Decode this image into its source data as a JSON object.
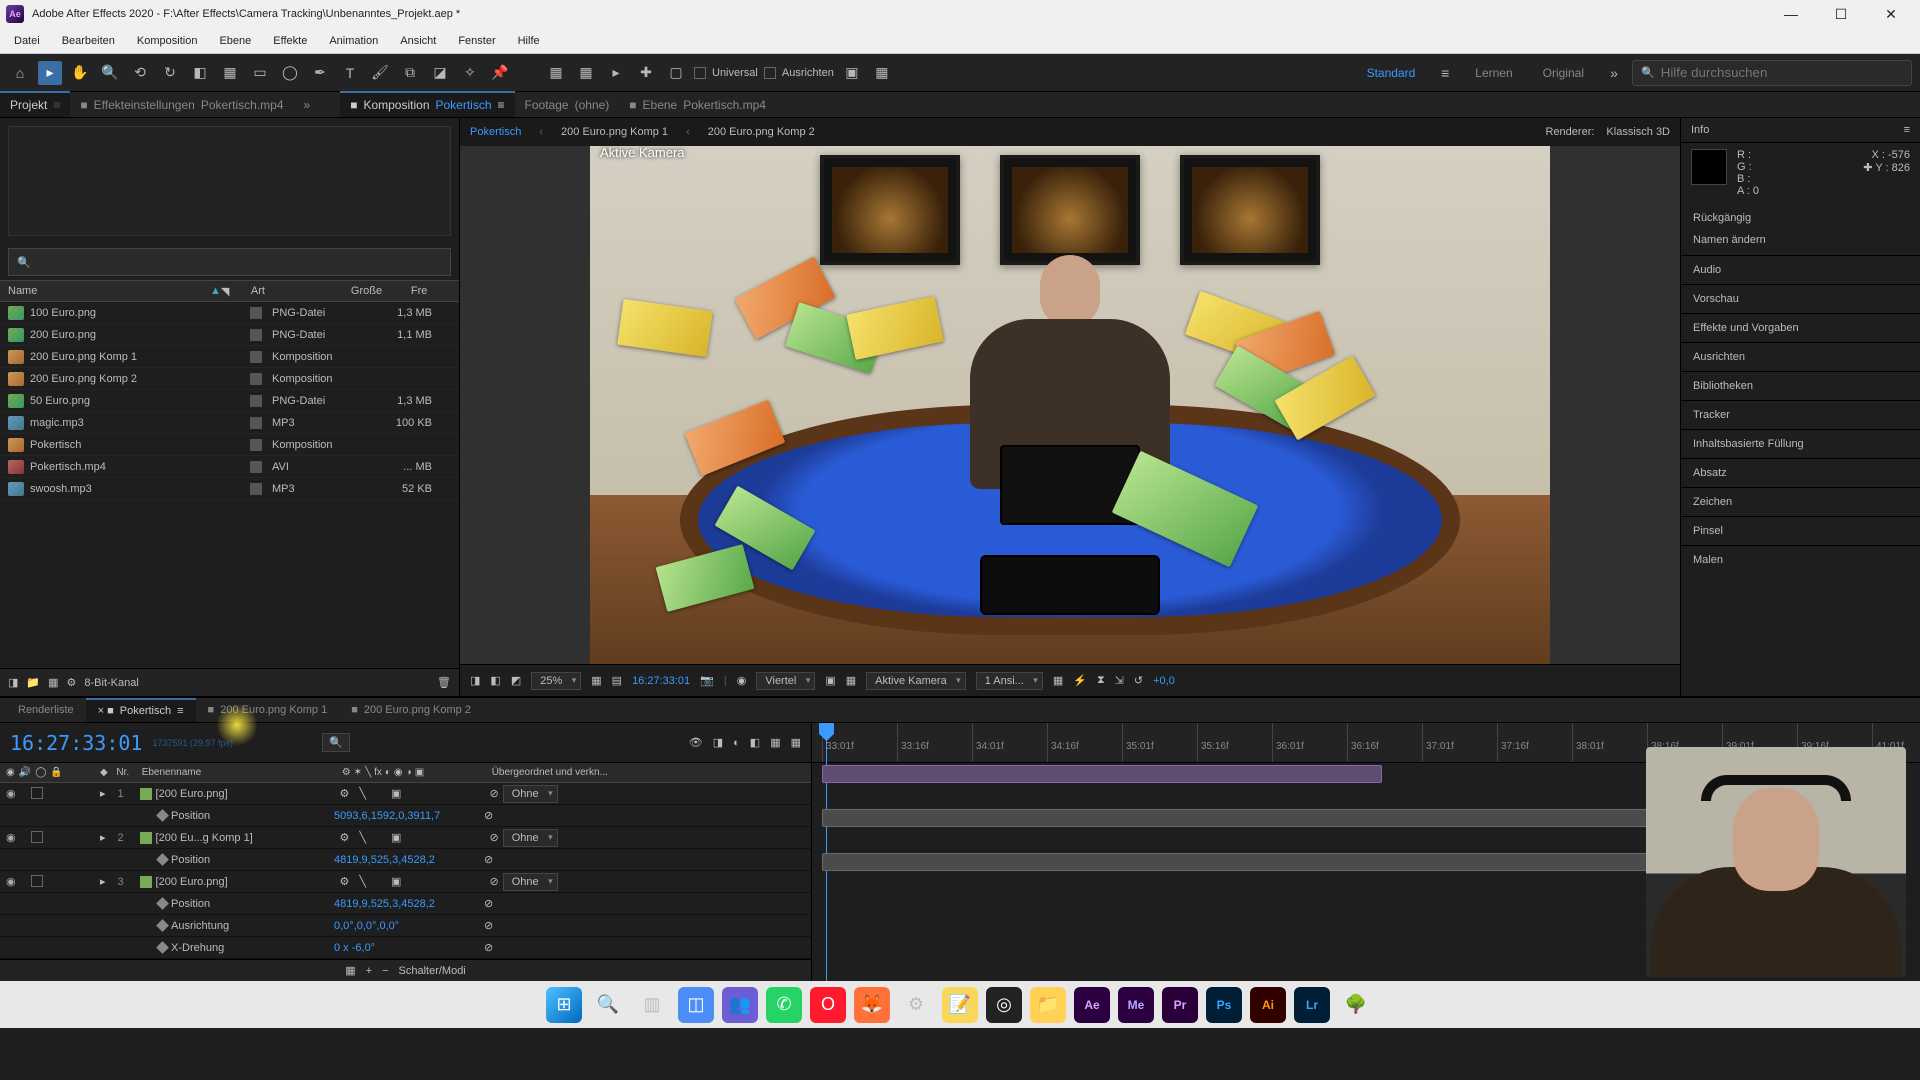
{
  "title": "Adobe After Effects 2020 - F:\\After Effects\\Camera Tracking\\Unbenanntes_Projekt.aep *",
  "menus": [
    "Datei",
    "Bearbeiten",
    "Komposition",
    "Ebene",
    "Effekte",
    "Animation",
    "Ansicht",
    "Fenster",
    "Hilfe"
  ],
  "toolbar": {
    "universal": "Universal",
    "align": "Ausrichten",
    "workspaces": {
      "standard": "Standard",
      "learn": "Lernen",
      "original": "Original"
    },
    "help_placeholder": "Hilfe durchsuchen"
  },
  "top_tabs": {
    "project": "Projekt",
    "effect_controls": {
      "label": "Effekteinstellungen",
      "item": "Pokertisch.mp4"
    },
    "comp": {
      "label": "Komposition",
      "item": "Pokertisch"
    },
    "footage": {
      "label": "Footage",
      "item": "(ohne)"
    },
    "layer": {
      "label": "Ebene",
      "item": "Pokertisch.mp4"
    }
  },
  "breadcrumb": [
    "Pokertisch",
    "200 Euro.png Komp 1",
    "200 Euro.png Komp 2"
  ],
  "renderer": {
    "label": "Renderer:",
    "value": "Klassisch 3D"
  },
  "project_panel": {
    "headers": {
      "name": "Name",
      "type": "Art",
      "size": "Große",
      "frame": "Fre"
    },
    "rows": [
      {
        "name": "100 Euro.png",
        "type": "PNG-Datei",
        "size": "1,3 MB",
        "icon": "png"
      },
      {
        "name": "200 Euro.png",
        "type": "PNG-Datei",
        "size": "1,1 MB",
        "icon": "png"
      },
      {
        "name": "200 Euro.png Komp 1",
        "type": "Komposition",
        "size": "",
        "icon": "comp"
      },
      {
        "name": "200 Euro.png Komp 2",
        "type": "Komposition",
        "size": "",
        "icon": "comp"
      },
      {
        "name": "50 Euro.png",
        "type": "PNG-Datei",
        "size": "1,3 MB",
        "icon": "png"
      },
      {
        "name": "magic.mp3",
        "type": "MP3",
        "size": "100 KB",
        "icon": "mp3"
      },
      {
        "name": "Pokertisch",
        "type": "Komposition",
        "size": "",
        "icon": "comp"
      },
      {
        "name": "Pokertisch.mp4",
        "type": "AVI",
        "size": "... MB",
        "icon": "avi"
      },
      {
        "name": "swoosh.mp3",
        "type": "MP3",
        "size": "52 KB",
        "icon": "mp3"
      }
    ],
    "footer": "8-Bit-Kanal"
  },
  "viewer": {
    "camera_label": "Aktive Kamera",
    "footer": {
      "zoom": "25%",
      "timecode": "16:27:33:01",
      "quality": "Viertel",
      "camera": "Aktive Kamera",
      "views": "1 Ansi...",
      "exposure": "+0,0"
    }
  },
  "info": {
    "title": "Info",
    "r": "R :",
    "g": "G :",
    "b": "B :",
    "a_label": "A :",
    "a_val": "0",
    "x_label": "X :",
    "x_val": "-576",
    "y_label": "Y :",
    "y_val": "826",
    "history": [
      "Rückgängig",
      "Namen ändern"
    ]
  },
  "panels": [
    "Audio",
    "Vorschau",
    "Effekte und Vorgaben",
    "Ausrichten",
    "Bibliotheken",
    "Tracker",
    "Inhaltsbasierte Füllung",
    "Absatz",
    "Zeichen",
    "Pinsel",
    "Malen"
  ],
  "timeline": {
    "tabs": [
      "Renderliste",
      "Pokertisch",
      "200 Euro.png Komp 1",
      "200 Euro.png Komp 2"
    ],
    "active_tab_index": 1,
    "timecode": "16:27:33:01",
    "frame_sub": "1737591 (29.97 fps)",
    "headers": {
      "nr": "Nr.",
      "name": "Ebenenname",
      "parent": "Übergeordnet und verkn..."
    },
    "none": "Ohne",
    "switch_modes": "Schalter/Modi",
    "layers": [
      {
        "nr": "1",
        "name": "[200 Euro.png]",
        "props": [
          {
            "name": "Position",
            "val": "5093,6,1592,0,3911,7"
          }
        ]
      },
      {
        "nr": "2",
        "name": "[200 Eu...g Komp 1]",
        "props": [
          {
            "name": "Position",
            "val": "4819,9,525,3,4528,2"
          }
        ]
      },
      {
        "nr": "3",
        "name": "[200 Euro.png]",
        "props": [
          {
            "name": "Position",
            "val": "4819,9,525,3,4528,2"
          },
          {
            "name": "Ausrichtung",
            "val": "0,0°,0,0°,0,0°"
          },
          {
            "name": "X-Drehung",
            "val": "0 x -6,0°"
          }
        ]
      }
    ],
    "ruler": [
      "33:01f",
      "33:16f",
      "34:01f",
      "34:16f",
      "35:01f",
      "35:16f",
      "36:01f",
      "36:16f",
      "37:01f",
      "37:16f",
      "38:01f",
      "38:16f",
      "39:01f",
      "39:16f",
      "41:01f"
    ]
  },
  "taskbar": {
    "apps": [
      "win",
      "search",
      "tasks",
      "widgets",
      "teams",
      "whatsapp",
      "opera",
      "firefox",
      "figure",
      "notes",
      "obs",
      "files",
      "ae",
      "me",
      "pr",
      "ps",
      "ai",
      "lr",
      "misc"
    ]
  }
}
